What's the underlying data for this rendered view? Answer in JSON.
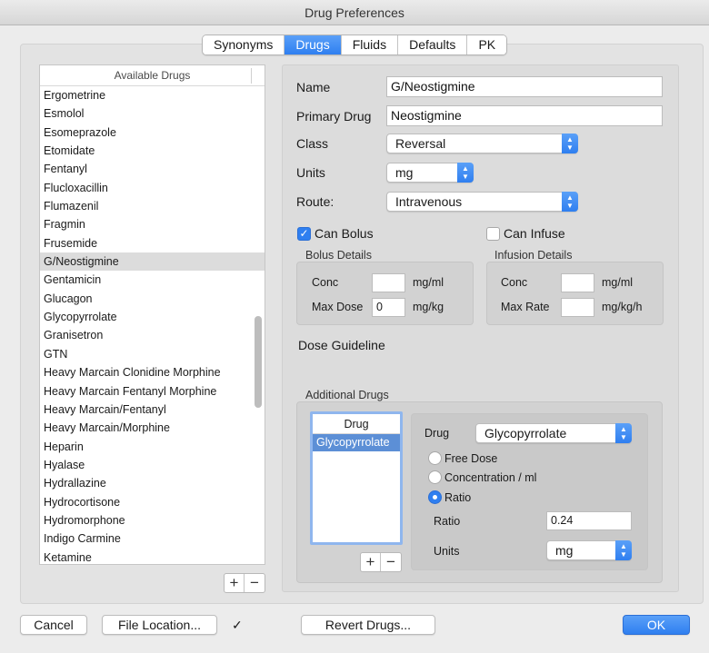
{
  "window": {
    "title": "Drug Preferences"
  },
  "tabs": [
    "Synonyms",
    "Drugs",
    "Fluids",
    "Defaults",
    "PK"
  ],
  "active_tab": "Drugs",
  "drug_list": {
    "header": "Available Drugs",
    "items": [
      "Ergometrine",
      "Esmolol",
      "Esomeprazole",
      "Etomidate",
      "Fentanyl",
      "Flucloxacillin",
      "Flumazenil",
      "Fragmin",
      "Frusemide",
      "G/Neostigmine",
      "Gentamicin",
      "Glucagon",
      "Glycopyrrolate",
      "Granisetron",
      "GTN",
      "Heavy Marcain Clonidine Morphine",
      "Heavy Marcain Fentanyl Morphine",
      "Heavy Marcain/Fentanyl",
      "Heavy Marcain/Morphine",
      "Heparin",
      "Hyalase",
      "Hydrallazine",
      "Hydrocortisone",
      "Hydromorphone",
      "Indigo Carmine",
      "Ketamine"
    ],
    "selected": "G/Neostigmine",
    "add_label": "+",
    "remove_label": "−"
  },
  "details": {
    "name_label": "Name",
    "name_value": "G/Neostigmine",
    "primary_label": "Primary Drug",
    "primary_value": "Neostigmine",
    "class_label": "Class",
    "class_value": "Reversal",
    "units_label": "Units",
    "units_value": "mg",
    "route_label": "Route:",
    "route_value": "Intravenous",
    "can_bolus_label": "Can Bolus",
    "can_bolus_checked": true,
    "can_infuse_label": "Can Infuse",
    "can_infuse_checked": false,
    "bolus": {
      "title": "Bolus Details",
      "conc_label": "Conc",
      "conc_value": "",
      "conc_unit": "mg/ml",
      "maxdose_label": "Max Dose",
      "maxdose_value": "0",
      "maxdose_unit": "mg/kg"
    },
    "infusion": {
      "title": "Infusion Details",
      "conc_label": "Conc",
      "conc_value": "",
      "conc_unit": "mg/ml",
      "maxrate_label": "Max Rate",
      "maxrate_value": "",
      "maxrate_unit": "mg/kg/h"
    },
    "dose_guideline_label": "Dose Guideline",
    "additional": {
      "title": "Additional Drugs",
      "list_header": "Drug",
      "list_items": [
        "Glycopyrrolate"
      ],
      "add_label": "+",
      "remove_label": "−",
      "drug_label": "Drug",
      "drug_value": "Glycopyrrolate",
      "options": [
        "Free Dose",
        "Concentration / ml",
        "Ratio"
      ],
      "selected_option": "Ratio",
      "ratio_label": "Ratio",
      "ratio_value": "0.24",
      "units_label": "Units",
      "units_value": "mg"
    }
  },
  "footer": {
    "cancel": "Cancel",
    "file_location": "File Location...",
    "checkmark": "✓",
    "revert": "Revert Drugs...",
    "ok": "OK"
  },
  "colors": {
    "accent": "#2f7ff0",
    "selection": "#5c8fd6"
  }
}
